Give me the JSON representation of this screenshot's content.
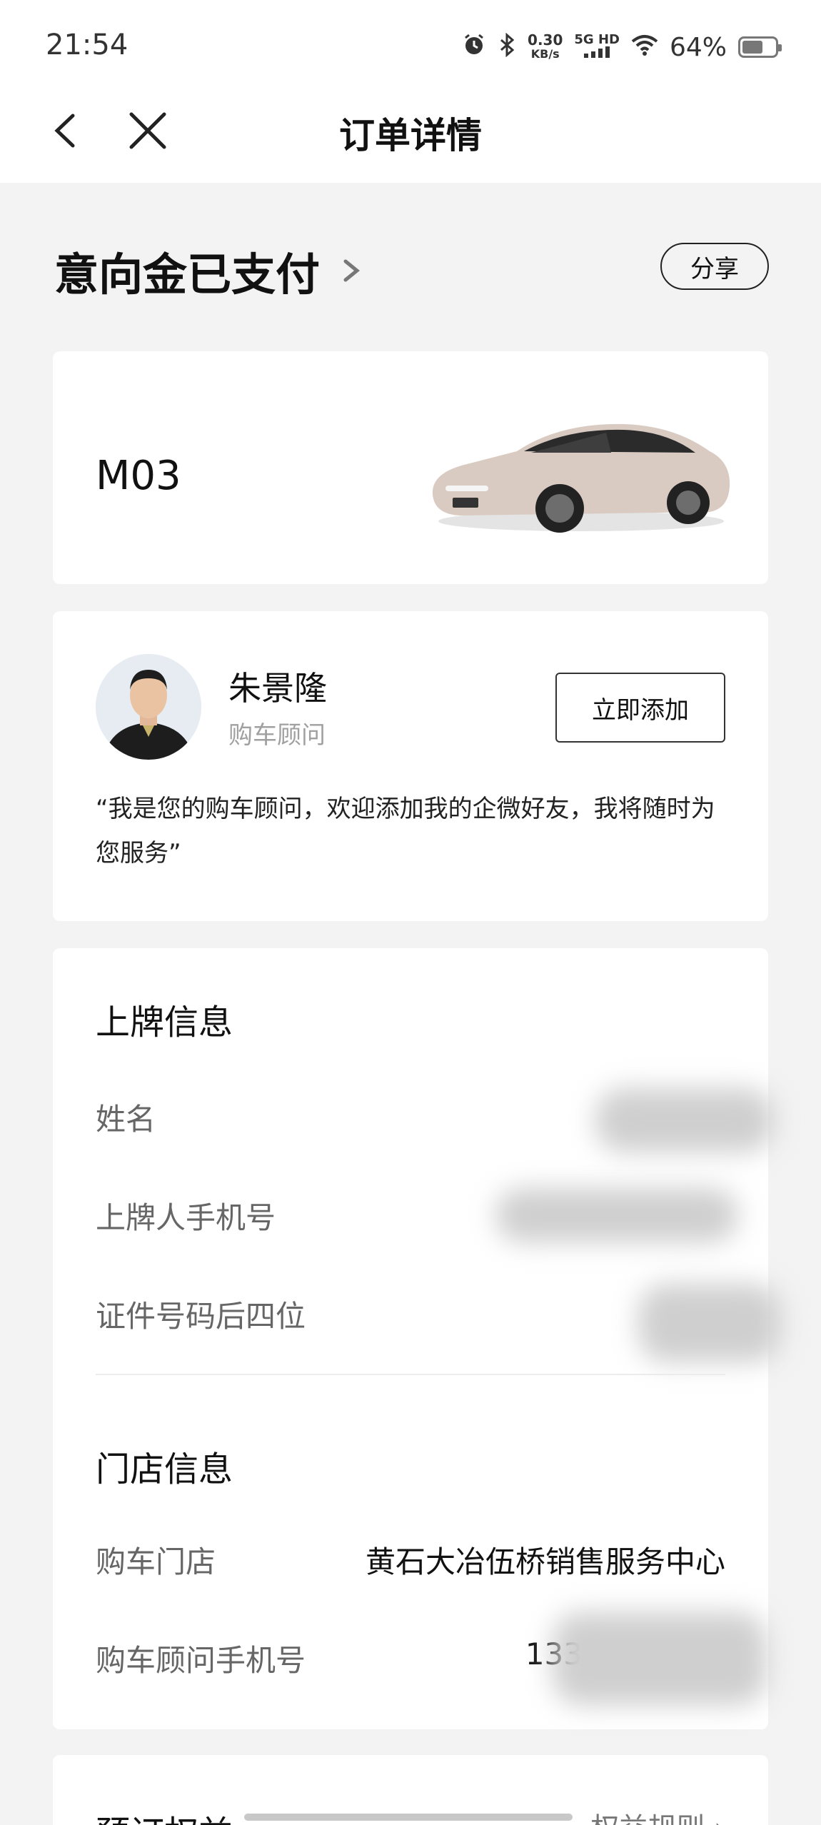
{
  "status_bar": {
    "time": "21:54",
    "net_speed_value": "0.30",
    "net_speed_unit": "KB/s",
    "signal_label": "5G HD",
    "battery_percent": "64%",
    "battery_level": 0.64
  },
  "nav": {
    "title": "订单详情",
    "back_icon": "chevron-left-icon",
    "close_icon": "close-icon"
  },
  "order": {
    "status": "意向金已支付",
    "share_label": "分享"
  },
  "vehicle": {
    "model": "M03",
    "image_icon": "car-image"
  },
  "advisor": {
    "name": "朱景隆",
    "role": "购车顾问",
    "add_label": "立即添加",
    "quote": "“我是您的购车顾问，欢迎添加我的企微好友，我将随时为您服务”"
  },
  "registration": {
    "title": "上牌信息",
    "rows": [
      {
        "label": "姓名",
        "value": ""
      },
      {
        "label": "上牌人手机号",
        "value": ""
      },
      {
        "label": "证件号码后四位",
        "value": ""
      }
    ]
  },
  "store": {
    "title": "门店信息",
    "rows": [
      {
        "label": "购车门店",
        "value": "黄石大冶伍桥销售服务中心"
      },
      {
        "label": "购车顾问手机号",
        "value": "133"
      }
    ]
  },
  "benefits": {
    "title": "预订权益",
    "link": "权益规则"
  },
  "colors": {
    "background": "#f3f3f3",
    "card": "#ffffff",
    "text_primary": "#111111",
    "text_secondary": "#666666",
    "text_muted": "#a0a0a0"
  }
}
